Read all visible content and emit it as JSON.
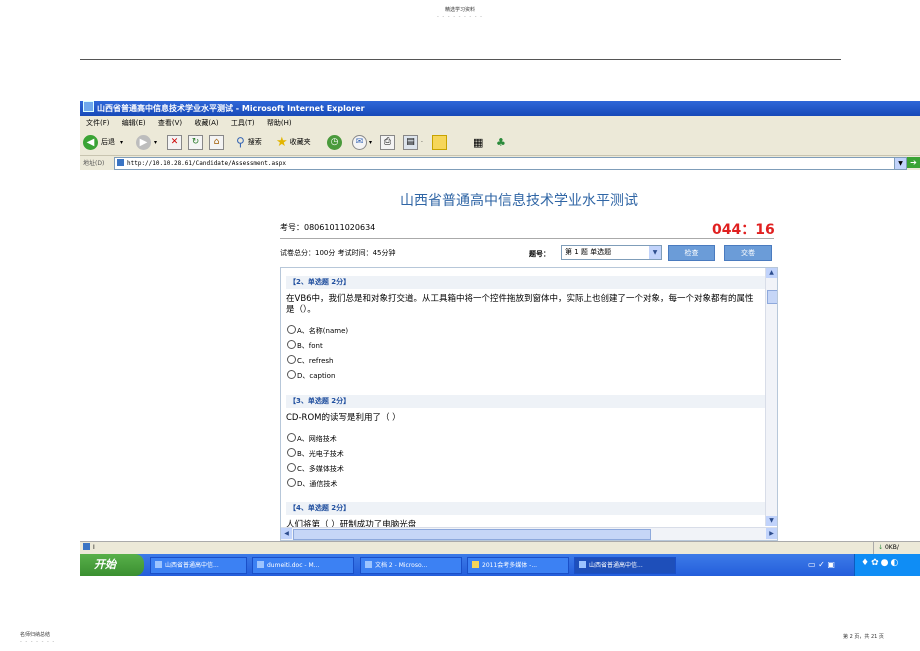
{
  "doc": {
    "header_text": "精选学习资料",
    "header_dots": "- - - - - - - - -",
    "footer_left": "名师归纳总结",
    "footer_left_dots": "- - - - - - -",
    "footer_right": "第 2 页，共 21 页"
  },
  "window": {
    "title": "山西省普通高中信息技术学业水平测试 - Microsoft Internet Explorer",
    "menu": [
      "文件(F)",
      "编辑(E)",
      "查看(V)",
      "收藏(A)",
      "工具(T)",
      "帮助(H)"
    ],
    "toolbar": {
      "back": "后退",
      "search": "搜索",
      "favorites": "收藏夹"
    },
    "address_label": "地址(D)",
    "address_value": "http://10.10.28.61/Candidate/Assessment.aspx"
  },
  "exam": {
    "title": "山西省普通高中信息技术学业水平测试",
    "candidate_id": "考号：08061011020634",
    "timer": "044：16",
    "info": "试卷总分：100分    考试时间：45分钟",
    "question_label": "题号：",
    "question_selected": "第 1 题 单选题",
    "check_button": "检查",
    "submit_button": "交卷"
  },
  "questions": [
    {
      "header": "【2、单选题  2分】",
      "text": "在VB6中，我们总是和对象打交道。从工具箱中将一个控件拖放到窗体中，实际上也创建了一个对象，每一个对象都有的属性是（）。",
      "options": [
        "A、名称(name)",
        "B、font",
        "C、refresh",
        "D、caption"
      ]
    },
    {
      "header": "【3、单选题  2分】",
      "text": "CD-ROM的读写是利用了（  ）",
      "options": [
        "A、网络技术",
        "B、光电子技术",
        "C、多媒体技术",
        "D、通信技术"
      ]
    },
    {
      "header": "【4、单选题  2分】",
      "text": "人们将第（  ）研制成功了电脑光盘"
    }
  ],
  "status": {
    "text": "Ⅰ",
    "right": "0KB/"
  },
  "taskbar": {
    "start": "开始",
    "tasks": [
      "山西省普通高中信...",
      "dumeiti.doc - M...",
      "文档 2 - Microso...",
      "2011会考多媒体 -...",
      "山西省普通高中信..."
    ]
  }
}
